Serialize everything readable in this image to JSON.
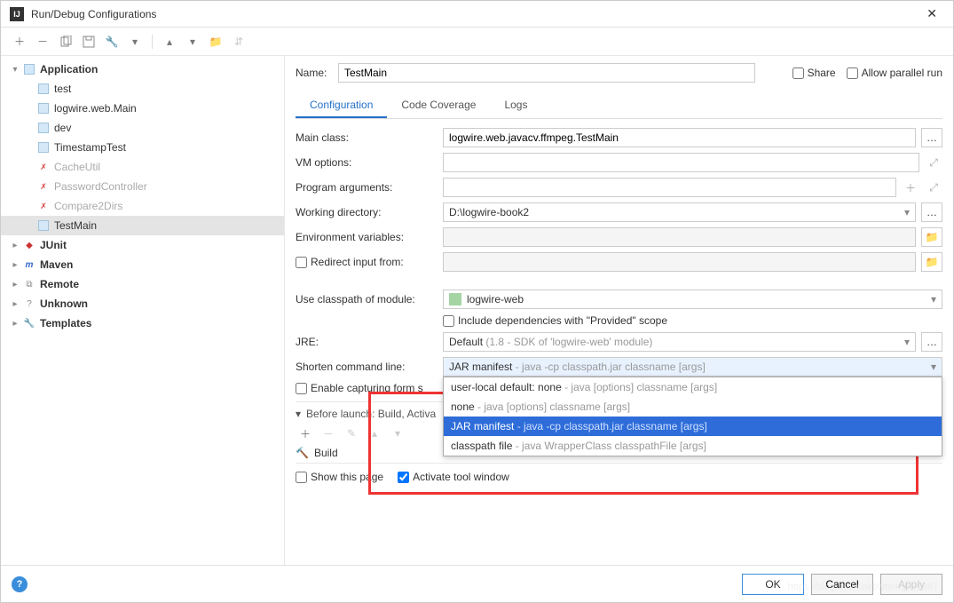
{
  "window": {
    "title": "Run/Debug Configurations"
  },
  "name_label": "Name:",
  "name_value": "TestMain",
  "checks": {
    "share": "Share",
    "parallel": "Allow parallel run"
  },
  "tabs": [
    "Configuration",
    "Code Coverage",
    "Logs"
  ],
  "sidebar": {
    "groups": [
      {
        "label": "Application",
        "expanded": true,
        "bold": true,
        "icon": "app"
      },
      {
        "label": "JUnit",
        "expanded": false,
        "bold": true,
        "icon": "junit"
      },
      {
        "label": "Maven",
        "expanded": false,
        "bold": true,
        "icon": "maven"
      },
      {
        "label": "Remote",
        "expanded": false,
        "bold": true,
        "icon": "remote"
      },
      {
        "label": "Unknown",
        "expanded": false,
        "bold": true,
        "icon": "unknown"
      },
      {
        "label": "Templates",
        "expanded": false,
        "bold": true,
        "icon": "templates"
      }
    ],
    "app_items": [
      {
        "label": "test",
        "valid": true
      },
      {
        "label": "logwire.web.Main",
        "valid": true
      },
      {
        "label": "dev",
        "valid": true
      },
      {
        "label": "TimestampTest",
        "valid": true
      },
      {
        "label": "CacheUtil",
        "valid": false
      },
      {
        "label": "PasswordController",
        "valid": false
      },
      {
        "label": "Compare2Dirs",
        "valid": false
      },
      {
        "label": "TestMain",
        "valid": true,
        "selected": true
      }
    ]
  },
  "form": {
    "main_class_label": "Main class:",
    "main_class_value": "logwire.web.javacv.ffmpeg.TestMain",
    "vm_options_label": "VM options:",
    "prog_args_label": "Program arguments:",
    "workdir_label": "Working directory:",
    "workdir_value": "D:\\logwire-book2",
    "env_label": "Environment variables:",
    "redirect_label": "Redirect input from:",
    "classpath_label": "Use classpath of module:",
    "classpath_value": "logwire-web",
    "provided_label": "Include dependencies with \"Provided\" scope",
    "jre_label": "JRE:",
    "jre_value": "Default",
    "jre_hint": "(1.8 - SDK of 'logwire-web' module)",
    "shorten_label": "Shorten command line:",
    "shorten_value": "JAR manifest",
    "shorten_hint": "- java -cp classpath.jar classname [args]",
    "enable_capture": "Enable capturing form s",
    "dropdown": [
      {
        "main": "user-local default: none",
        "hint": "- java [options] classname [args]"
      },
      {
        "main": "none",
        "hint": "- java [options] classname [args]"
      },
      {
        "main": "JAR manifest",
        "hint": "- java -cp classpath.jar classname [args]",
        "selected": true
      },
      {
        "main": "classpath file",
        "hint": "- java WrapperClass classpathFile [args]"
      }
    ]
  },
  "before_launch": {
    "header": "Before launch: Build, Activa",
    "build": "Build"
  },
  "footer_checks": {
    "show_page": "Show this page",
    "activate_window": "Activate tool window"
  },
  "buttons": {
    "ok": "OK",
    "cancel": "Cancel",
    "apply": "Apply"
  },
  "watermark": "https://blog.csdn.net/lvhonglei1987"
}
